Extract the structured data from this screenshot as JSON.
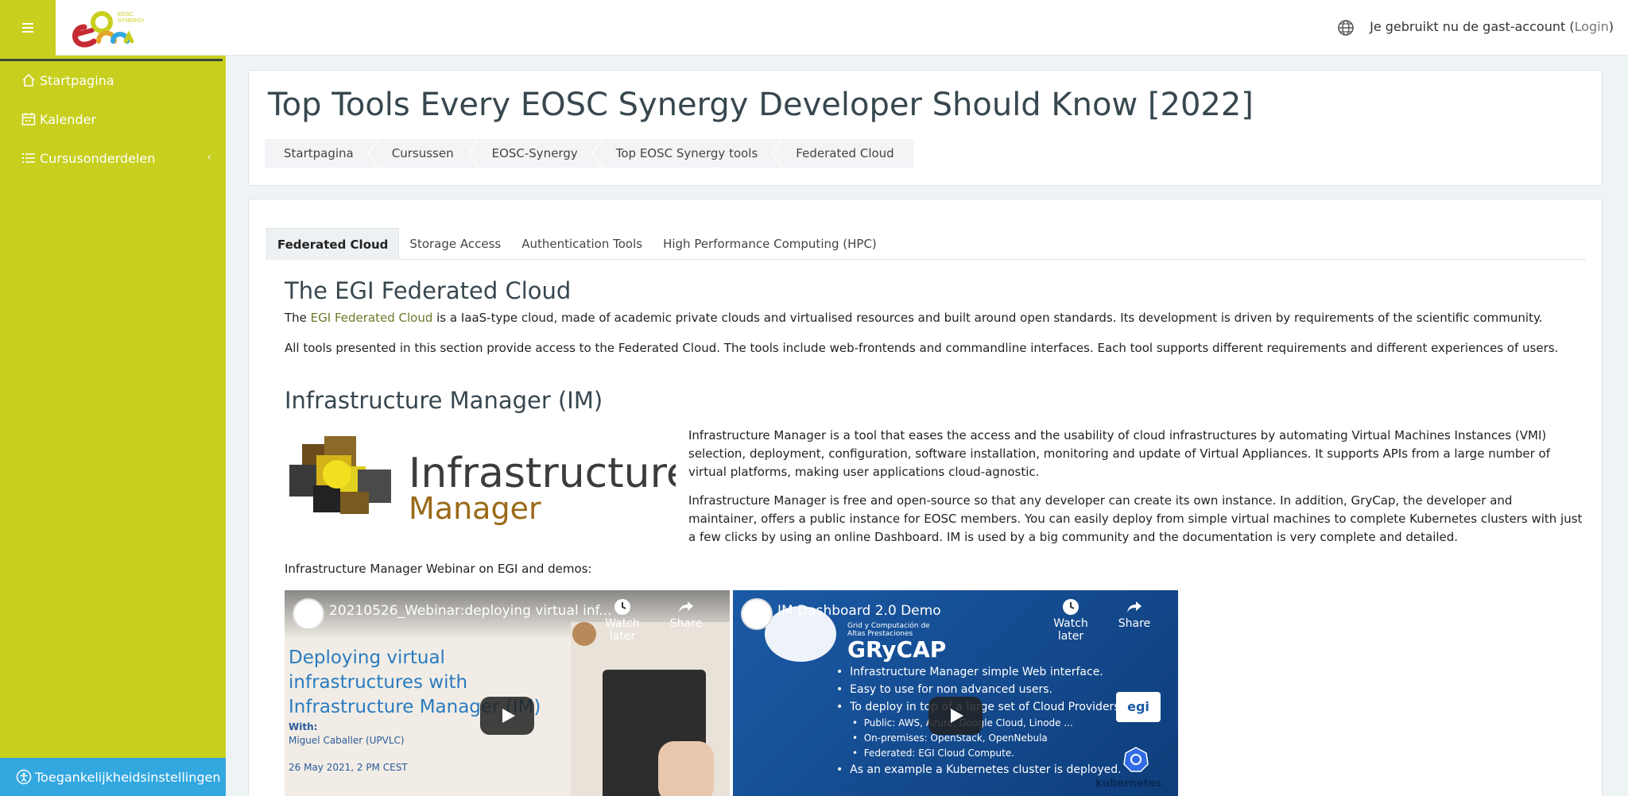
{
  "topbar": {
    "guest_text": "Je gebruikt nu de gast-account (",
    "login_label": "Login",
    "guest_text_end": ")"
  },
  "logo": {
    "small_text_1": "EOSC",
    "small_text_2": "SYNERGY"
  },
  "sidebar": {
    "items": [
      {
        "label": "Startpagina"
      },
      {
        "label": "Kalender"
      },
      {
        "label": "Cursusonderdelen"
      }
    ],
    "accessibility_label": "Toegankelijkheidsinstellingen"
  },
  "header": {
    "title": "Top Tools Every EOSC Synergy Developer Should Know [2022]",
    "breadcrumb": [
      "Startpagina",
      "Cursussen",
      "EOSC-Synergy",
      "Top EOSC Synergy tools",
      "Federated Cloud"
    ]
  },
  "tabs": [
    {
      "label": "Federated Cloud"
    },
    {
      "label": "Storage Access"
    },
    {
      "label": "Authentication Tools"
    },
    {
      "label": "High Performance Computing (HPC)"
    }
  ],
  "section1": {
    "heading": "The EGI Federated Cloud",
    "p1_start": "The ",
    "p1_link": "EGI Federated Cloud",
    "p1_end": " is a IaaS-type cloud, made of academic private clouds and virtualised resources and built around open standards. Its development is driven by requirements of the scientific community.",
    "p2": "All tools presented in this section provide access to the Federated Cloud. The tools include web-frontends and commandline interfaces. Each tool supports different requirements and different experiences of users."
  },
  "section2": {
    "heading": "Infrastructure Manager (IM)",
    "logo_word_1": "Infrastructure",
    "logo_word_2": "Manager",
    "p1": "Infrastructure Manager is a tool that eases the access and the usability of cloud infrastructures by automating Virtual Machines Instances (VMI) selection, deployment, configuration, software installation, monitoring and update of Virtual Appliances. It supports APIs from a large number of virtual platforms, making user applications cloud-agnostic.",
    "p2": "Infrastructure Manager is free and open-source so that any developer can create its own instance. In addition, GryCap, the developer and maintainer, offers a public instance for EOSC members. You can easily deploy from simple virtual machines to complete Kubernetes clusters with just a few clicks by using an online Dashboard. IM is used by a big community and the documentation is very complete and detailed.",
    "webinar_intro": "Infrastructure Manager Webinar on EGI and demos:"
  },
  "videos": [
    {
      "title": "20210526_Webinar:deploying virtual inf...",
      "watch_later": "Watch later",
      "share": "Share",
      "slide_title": "Deploying virtual infrastructures with Infrastructure Manager (IM)",
      "with": "With:",
      "presenter": "Miguel Caballer (UPVLC)",
      "date": "26 May 2021, 2 PM CEST"
    },
    {
      "title": "IM Dashboard 2.0 Demo",
      "watch_later": "Watch later",
      "share": "Share",
      "brand_sub": "Grid y Computación de Altas Prestaciones",
      "brand": "GRyCAP",
      "bullets": [
        "Infrastructure Manager simple Web interface.",
        "Easy to use for non advanced users.",
        "To deploy in top of a large set of Cloud Providers.",
        "Public: AWS, Azure, Google Cloud, Linode ...",
        "On-premises: OpenStack, OpenNebula",
        "Federated: EGI Cloud Compute.",
        "As an example a Kubernetes cluster is deployed."
      ],
      "egi_badge": "egi",
      "k8s_label": "kubernetes"
    }
  ],
  "colors": {
    "sidebar": "#c8cf1e",
    "accessibility": "#33a8e0",
    "title": "#37474f",
    "link": "#6b7a2a"
  }
}
